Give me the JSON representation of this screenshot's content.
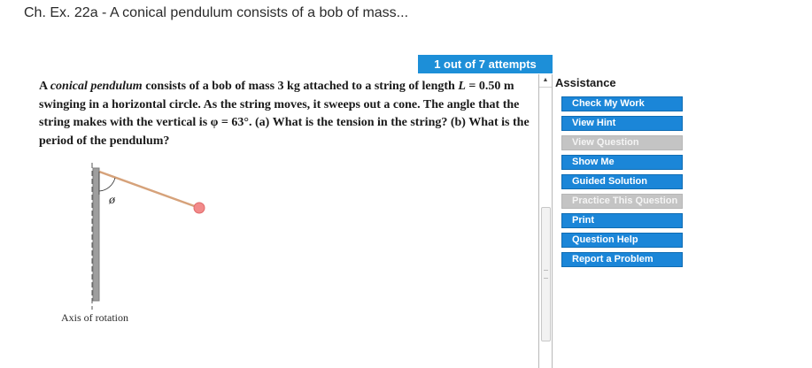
{
  "page": {
    "title": "Ch. Ex. 22a - A conical pendulum consists of a bob of mass..."
  },
  "attempts": {
    "label": "1 out of 7 attempts"
  },
  "question": {
    "part1": "A ",
    "term": "conical pendulum",
    "part2": " consists of a bob of mass 3 kg attached to a string of length ",
    "length_var": "L",
    "part3": " = 0.50 m swinging in a horizontal circle. As the string moves, it sweeps out a cone. The angle that the string makes with the vertical is φ = 63°. (a) What is the tension in the string? (b) What is the period of the pendulum?"
  },
  "figure": {
    "angle_symbol": "ø",
    "axis_label": "Axis of rotation",
    "string_color": "#d6a27a",
    "bob_color": "#f28a8a",
    "pole_color": "#9e9e9e"
  },
  "assistance": {
    "heading": "Assistance",
    "buttons": [
      {
        "label": "Check My Work",
        "enabled": true
      },
      {
        "label": "View Hint",
        "enabled": true
      },
      {
        "label": "View Question",
        "enabled": false
      },
      {
        "label": "Show Me",
        "enabled": true
      },
      {
        "label": "Guided Solution",
        "enabled": true
      },
      {
        "label": "Practice This Question",
        "enabled": false
      },
      {
        "label": "Print",
        "enabled": true
      },
      {
        "label": "Question Help",
        "enabled": true
      },
      {
        "label": "Report a Problem",
        "enabled": true
      }
    ]
  },
  "scrollbar": {
    "up_arrow_icon": "triangle-up-icon"
  }
}
